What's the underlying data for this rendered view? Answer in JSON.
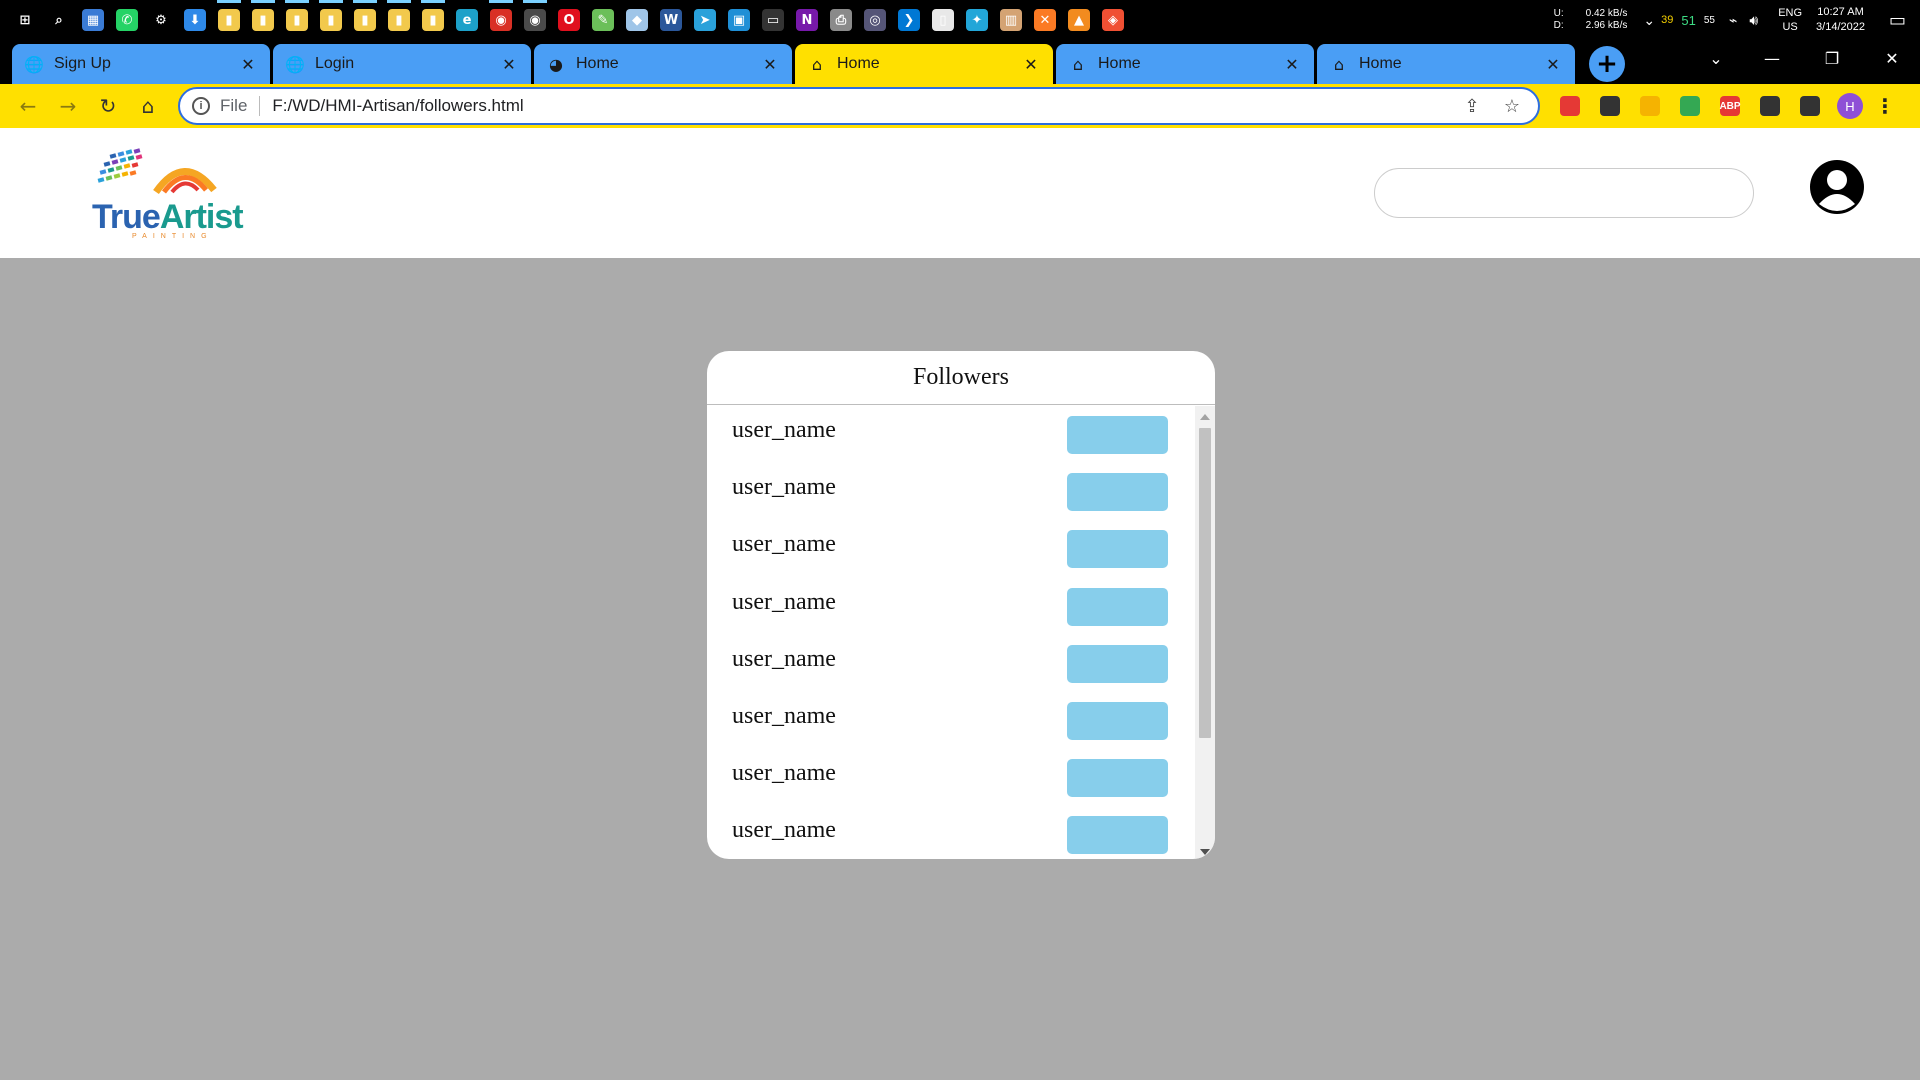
{
  "taskbar": {
    "icons": [
      {
        "name": "windows-start-icon",
        "glyph": "⊞",
        "color": "#000000",
        "running": false
      },
      {
        "name": "search-icon",
        "glyph": "⌕",
        "color": "#000000",
        "running": false
      },
      {
        "name": "control-panel-icon",
        "glyph": "▦",
        "color": "#3a7bd5",
        "running": false
      },
      {
        "name": "whatsapp-icon",
        "glyph": "✆",
        "color": "#25d366",
        "running": false
      },
      {
        "name": "settings-gear-icon",
        "glyph": "⚙",
        "color": "#000000",
        "running": false
      },
      {
        "name": "download-arrow-icon",
        "glyph": "⬇",
        "color": "#2e89e8",
        "running": false
      },
      {
        "name": "folder-icon",
        "glyph": "▮",
        "color": "#f2c94c",
        "running": true
      },
      {
        "name": "folder-icon",
        "glyph": "▮",
        "color": "#f2c94c",
        "running": true
      },
      {
        "name": "folder-icon",
        "glyph": "▮",
        "color": "#f2c94c",
        "running": true
      },
      {
        "name": "folder-icon",
        "glyph": "▮",
        "color": "#f2c94c",
        "running": true
      },
      {
        "name": "folder-icon",
        "glyph": "▮",
        "color": "#f2c94c",
        "running": true
      },
      {
        "name": "folder-icon",
        "glyph": "▮",
        "color": "#f2c94c",
        "running": true
      },
      {
        "name": "folder-icon",
        "glyph": "▮",
        "color": "#f2c94c",
        "running": true
      },
      {
        "name": "edge-icon",
        "glyph": "e",
        "color": "#1da1c9",
        "running": false
      },
      {
        "name": "chrome-icon",
        "glyph": "◉",
        "color": "#d93025",
        "running": true
      },
      {
        "name": "chrome-icon",
        "glyph": "◉",
        "color": "#4a4a4a",
        "running": true
      },
      {
        "name": "opera-icon",
        "glyph": "O",
        "color": "#e0101e",
        "running": false
      },
      {
        "name": "notepad-icon",
        "glyph": "✎",
        "color": "#6bbf59",
        "running": false
      },
      {
        "name": "paint-icon",
        "glyph": "◆",
        "color": "#9fc5e8",
        "running": false
      },
      {
        "name": "word-icon",
        "glyph": "W",
        "color": "#2b579a",
        "running": false
      },
      {
        "name": "telegram-icon",
        "glyph": "➤",
        "color": "#2aa1da",
        "running": false
      },
      {
        "name": "remote-desktop-icon",
        "glyph": "▣",
        "color": "#1f8fd6",
        "running": false
      },
      {
        "name": "terminal-icon",
        "glyph": "▭",
        "color": "#333333",
        "running": false
      },
      {
        "name": "onenote-icon",
        "glyph": "N",
        "color": "#7719aa",
        "running": false
      },
      {
        "name": "printer-icon",
        "glyph": "⎙",
        "color": "#8a8a8a",
        "running": false
      },
      {
        "name": "disk-icon",
        "glyph": "◎",
        "color": "#555577",
        "running": false
      },
      {
        "name": "vscode-icon",
        "glyph": "❯",
        "color": "#0078d4",
        "running": false
      },
      {
        "name": "file-icon",
        "glyph": "▯",
        "color": "#e8e8e8",
        "running": false
      },
      {
        "name": "bulb-icon",
        "glyph": "✦",
        "color": "#22a6d8",
        "running": false
      },
      {
        "name": "books-icon",
        "glyph": "▥",
        "color": "#d4a373",
        "running": false
      },
      {
        "name": "xampp-icon",
        "glyph": "✕",
        "color": "#fb7a24",
        "running": false
      },
      {
        "name": "vlc-icon",
        "glyph": "▲",
        "color": "#f28b1f",
        "running": false
      },
      {
        "name": "git-icon",
        "glyph": "◈",
        "color": "#f05033",
        "running": false
      }
    ],
    "tray": {
      "net_labels": [
        "U:",
        "D:"
      ],
      "net_rates": [
        "0.42 kB/s",
        "2.96 kB/s"
      ],
      "num_a": "39",
      "num_b": "51",
      "num_c": "55",
      "lang_top": "ENG",
      "lang_bottom": "US",
      "time": "10:27 AM",
      "date": "3/14/2022"
    }
  },
  "browser": {
    "tabs": [
      {
        "title": "Sign Up",
        "icon": "globe-icon",
        "glyph": "🌐",
        "active": false
      },
      {
        "title": "Login",
        "icon": "globe-icon",
        "glyph": "🌐",
        "active": false
      },
      {
        "title": "Home",
        "icon": "user-circle-icon",
        "glyph": "◕",
        "active": false
      },
      {
        "title": "Home",
        "icon": "home-icon",
        "glyph": "⌂",
        "active": true
      },
      {
        "title": "Home",
        "icon": "home-icon",
        "glyph": "⌂",
        "active": false
      },
      {
        "title": "Home",
        "icon": "home-icon",
        "glyph": "⌂",
        "active": false
      }
    ],
    "address": {
      "scheme": "File",
      "url": "F:/WD/HMI-Artisan/followers.html"
    },
    "extensions": [
      {
        "name": "bookmark-red-icon",
        "text": "",
        "color": "#e53935"
      },
      {
        "name": "spy-glasses-icon",
        "text": "",
        "color": "#333333"
      },
      {
        "name": "flag-icon",
        "text": "",
        "color": "#f5b301"
      },
      {
        "name": "color-wheel-icon",
        "text": "",
        "color": "#34a853"
      },
      {
        "name": "adblock-icon",
        "text": "ABP",
        "color": "#e53935"
      },
      {
        "name": "puzzle-icon",
        "text": "",
        "color": "#333333"
      },
      {
        "name": "media-queue-icon",
        "text": "",
        "color": "#333333"
      }
    ],
    "profile_letter": "H"
  },
  "site": {
    "logo_word_1": "True",
    "logo_word_2": "Artist",
    "logo_sub": "PAINTING",
    "search_placeholder": ""
  },
  "followers": {
    "title": "Followers",
    "items": [
      {
        "username": "user_name"
      },
      {
        "username": "user_name"
      },
      {
        "username": "user_name"
      },
      {
        "username": "user_name"
      },
      {
        "username": "user_name"
      },
      {
        "username": "user_name"
      },
      {
        "username": "user_name"
      },
      {
        "username": "user_name"
      }
    ]
  },
  "colors": {
    "page_bg": "#ababab",
    "follow_button": "#87ceeb",
    "tab_inactive": "#4a9ef5",
    "tab_active": "#ffe000"
  }
}
